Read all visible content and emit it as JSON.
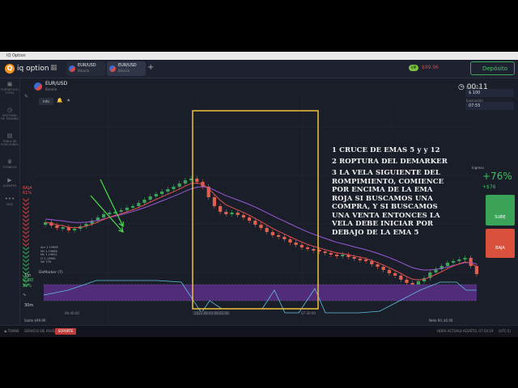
{
  "window": {
    "title": "IQ Option"
  },
  "header": {
    "brand": "iq option",
    "tabs": [
      {
        "name": "EUR/USD",
        "type": "Binaria"
      },
      {
        "name": "EUR/USD",
        "type": "Binaria"
      }
    ],
    "balance": "$99.96",
    "deposit_label": "Depósito",
    "vip_label": "VIP"
  },
  "sidebar": {
    "items": [
      {
        "label": "PORTAFOLIO TOTAL",
        "icon": "briefcase-icon"
      },
      {
        "label": "HISTORIAL DE TRADING",
        "icon": "history-icon"
      },
      {
        "label": "TABLA DE POSICIONES",
        "icon": "chat-icon"
      },
      {
        "label": "TORNEOS",
        "icon": "trophy-icon"
      },
      {
        "label": "AGENTES",
        "icon": "video-icon"
      },
      {
        "label": "MÁS",
        "icon": "more-icon"
      }
    ]
  },
  "asset": {
    "name": "EUR/USD",
    "type": "Binaria",
    "info_label": "Info"
  },
  "timer": "00:11",
  "sentiment": {
    "down_label": "BAJA",
    "down_pct": "61%",
    "up_label": "SUBE",
    "up_pct": "39%"
  },
  "right_panel": {
    "amount_label": "Inversión",
    "amount": "$ 100",
    "expiry_label": "Expiración",
    "expiry": "07:55",
    "payout_label": "Ingreso",
    "payout": "+76%",
    "profit": "+$76",
    "up_button": "SUBE",
    "down_button": "BAJA"
  },
  "annotations": {
    "line1": "1 CRUCE DE EMAS 5 y  y 12",
    "line2": "2 ROPTURA DEL DEMARKER",
    "line3": [
      "3 LA VELA SIGUIENTE DEL",
      "ROMPIMIENTO, COMIENCE",
      "POR ENCIMA DE LA EMA",
      "ROJA SI BUSCAMOS UNA",
      "COMPRA, Y SI BUSCAMOS",
      "UNA VENTA ENTONCES LA",
      "VELA DEBE INICIAR POR",
      "DEBAJO DE LA EMA 5"
    ]
  },
  "indicator": {
    "label": "DeMarker (7)"
  },
  "timeframes": [
    "1m",
    "30m"
  ],
  "ohlc": [
    "Apr   1.19658",
    "Mx    1.19686",
    "Mn    1.19651",
    "Cl    1.19661",
    "Vol   776"
  ],
  "x_labels": [
    "06:40:00",
    "2021-08-03  06:02:00",
    "07:30:00"
  ],
  "footer": {
    "chat_label": "TOKNS",
    "support_prefix": "SERVICIO DE AYUDA",
    "support_label": "SOPORTE",
    "current_time_label": "HORA ACTUAL:",
    "current_time": "3 AGOSTO, 07:54:19",
    "tz": "(UTC-5)",
    "balance_label": "Saldo",
    "balance_value": "$99.96",
    "net_pl_label": "Neto P/L",
    "net_pl_value": "$0.00"
  },
  "colors": {
    "up": "#3aa357",
    "down": "#e0604f",
    "ema_fast": "#e05050",
    "ema_slow": "#9b59d6",
    "highlight": "#f0c23a",
    "arrow": "#4ae04a",
    "demarker_fill": "#5a2f8a",
    "demarker_line": "#5fc0e0"
  }
}
